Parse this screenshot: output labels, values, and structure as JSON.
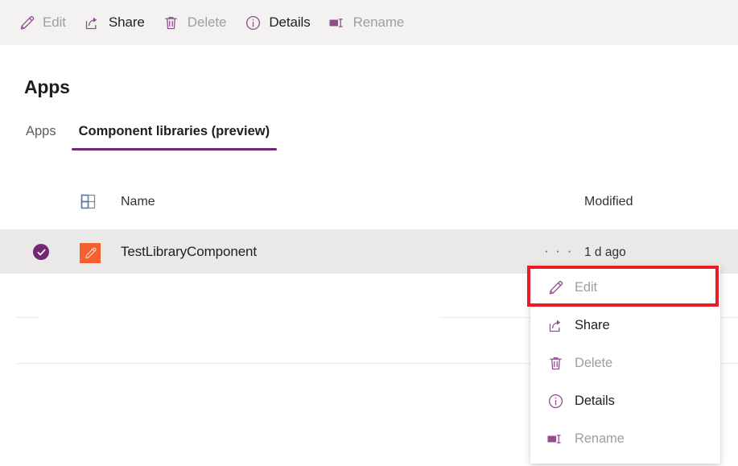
{
  "colors": {
    "accent_purple": "#742774",
    "icon_purple": "#8f4f8f",
    "app_tile_orange": "#f4602e",
    "toolbar_background": "#f3f2f1",
    "selected_row_background": "#ebe9e7",
    "disabled_text": "#a19f9d",
    "enabled_text": "#201f1e",
    "highlight_red": "#ed1c24"
  },
  "command_bar": {
    "items": [
      {
        "label": "Edit",
        "icon": "pencil-icon",
        "enabled": false
      },
      {
        "label": "Share",
        "icon": "share-icon",
        "enabled": true
      },
      {
        "label": "Delete",
        "icon": "trash-icon",
        "enabled": false
      },
      {
        "label": "Details",
        "icon": "info-icon",
        "enabled": true
      },
      {
        "label": "Rename",
        "icon": "rename-icon",
        "enabled": false
      }
    ]
  },
  "page": {
    "title": "Apps"
  },
  "tabs": [
    {
      "label": "Apps",
      "selected": false
    },
    {
      "label": "Component libraries (preview)",
      "selected": true
    }
  ],
  "list": {
    "columns": {
      "grid_icon": "table-column-icon",
      "name": "Name",
      "modified": "Modified"
    },
    "rows": [
      {
        "selected": true,
        "app_icon": "orange-pencil-app-icon",
        "name": "TestLibraryComponent",
        "overflow": "· · ·",
        "modified": "1 d ago"
      }
    ]
  },
  "context_menu": {
    "items": [
      {
        "label": "Edit",
        "icon": "pencil-icon",
        "enabled": false,
        "highlighted": true
      },
      {
        "label": "Share",
        "icon": "share-icon",
        "enabled": true,
        "highlighted": false
      },
      {
        "label": "Delete",
        "icon": "trash-icon",
        "enabled": false,
        "highlighted": false
      },
      {
        "label": "Details",
        "icon": "info-icon",
        "enabled": true,
        "highlighted": false
      },
      {
        "label": "Rename",
        "icon": "rename-icon",
        "enabled": false,
        "highlighted": false
      }
    ]
  }
}
